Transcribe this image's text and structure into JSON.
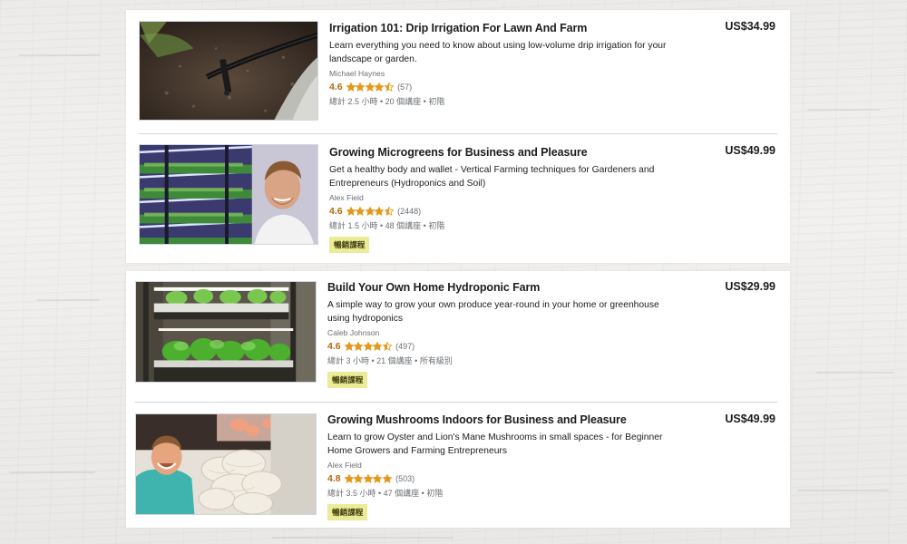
{
  "courses": [
    {
      "title": "Irrigation 101: Drip Irrigation For Lawn And Farm",
      "description": "Learn everything you need to know about using low-volume drip irrigation for your landscape or garden.",
      "author": "Michael Haynes",
      "rating": "4.6",
      "stars_value": 4.5,
      "reviews": "(57)",
      "meta": "總計 2.5 小時 • 20 個講座 • 初階",
      "price": "US$34.99",
      "badge": "",
      "thumbnail_icon": "drip-irrigation-photo"
    },
    {
      "title": "Growing Microgreens for Business and Pleasure",
      "description": "Get a healthy body and wallet - Vertical Farming techniques for Gardeners and Entrepreneurs (Hydroponics and Soil)",
      "author": "Alex Field",
      "rating": "4.6",
      "stars_value": 4.5,
      "reviews": "(2448)",
      "meta": "總計 1.5 小時 • 48 個講座 • 初階",
      "price": "US$49.99",
      "badge": "暢銷課程",
      "thumbnail_icon": "microgreens-instructor-photo"
    },
    {
      "title": "Build Your Own Home Hydroponic Farm",
      "description": "A simple way to grow your own produce year-round in your home or greenhouse using hydroponics",
      "author": "Caleb Johnson",
      "rating": "4.6",
      "stars_value": 4.5,
      "reviews": "(497)",
      "meta": "總計 3 小時 • 21 個講座 • 所有級別",
      "price": "US$29.99",
      "badge": "暢銷課程",
      "thumbnail_icon": "hydroponic-rack-photo"
    },
    {
      "title": "Growing Mushrooms Indoors for Business and Pleasure",
      "description": "Learn to grow Oyster and Lion's Mane Mushrooms in small spaces - for Beginner Home Growers and Farming Entrepreneurs",
      "author": "Alex Field",
      "rating": "4.8",
      "stars_value": 5,
      "reviews": "(503)",
      "meta": "總計 3.5 小時 • 47 個講座 • 初階",
      "price": "US$49.99",
      "badge": "暢銷課程",
      "thumbnail_icon": "mushroom-instructor-photo"
    }
  ],
  "colors": {
    "rating": "#b4690e",
    "star": "#e59819",
    "badge_bg": "#eceb98",
    "text": "#1c1d1f",
    "muted": "#6a6f73"
  }
}
